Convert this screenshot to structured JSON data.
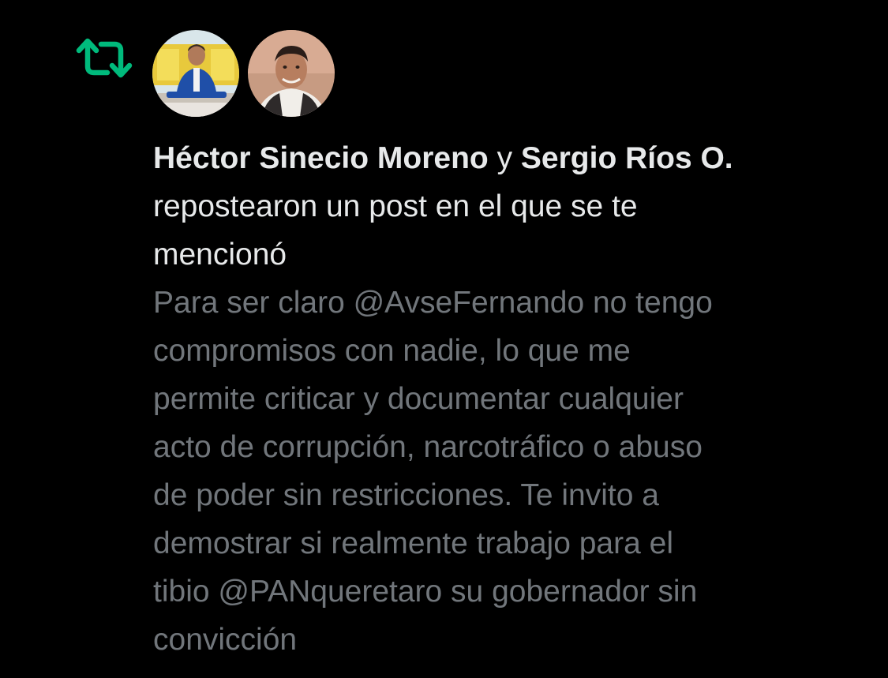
{
  "notification": {
    "type_icon": "repost-icon",
    "accent_color": "#00ba7c",
    "avatars": [
      {
        "name": "Héctor Sinecio Moreno",
        "icon": "avatar-photo"
      },
      {
        "name": "Sergio Ríos O.",
        "icon": "avatar-photo"
      }
    ],
    "user1": "Héctor Sinecio Moreno",
    "connector": "y",
    "user2": "Sergio Ríos O.",
    "action_line1": "repostearon un post en el que se te",
    "action_line2": "mencionó",
    "post_lines": [
      "Para ser claro @AvseFernando no tengo",
      "compromisos con nadie, lo que me",
      "permite criticar y documentar cualquier",
      "acto de corrupción, narcotráfico o abuso",
      "de poder sin restricciones. Te invito a",
      "demostrar si realmente trabajo para el",
      "tibio @PANqueretaro su gobernador sin",
      "convicción"
    ]
  }
}
